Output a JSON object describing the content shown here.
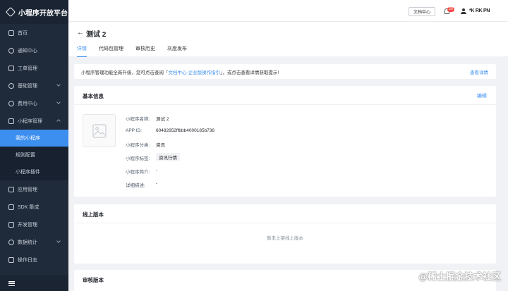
{
  "brand": {
    "title": "小程序开放平台"
  },
  "sidebar": {
    "items": [
      {
        "label": "首页"
      },
      {
        "label": "通知中心"
      },
      {
        "label": "工单管理"
      },
      {
        "label": "基础管理"
      },
      {
        "label": "费用中心"
      },
      {
        "label": "小程序管理"
      },
      {
        "label": "我的小程序"
      },
      {
        "label": "规则配置"
      },
      {
        "label": "小程序插件"
      },
      {
        "label": "应用管理"
      },
      {
        "label": "SDK 集成"
      },
      {
        "label": "开发管理"
      },
      {
        "label": "数据统计"
      },
      {
        "label": "操作日志"
      }
    ]
  },
  "header": {
    "doc_button": "文档中心",
    "notif_count": "20",
    "username": "*K RK PN"
  },
  "page": {
    "back": "←",
    "title": "测试 2",
    "tabs": [
      {
        "label": "详情"
      },
      {
        "label": "代码包管理"
      },
      {
        "label": "审核历史"
      },
      {
        "label": "灰度发布"
      }
    ]
  },
  "notice": {
    "text_before": "小程序管理功能全新升级，您可点击查阅「",
    "link": "文档中心-企业版操作指引",
    "text_after": "」，或点击查看详情获取提示!",
    "action": "查看详情"
  },
  "basic_info": {
    "title": "基本信息",
    "edit": "编辑",
    "fields": [
      {
        "label": "小程序名称:",
        "value": "测试 2"
      },
      {
        "label": "APP ID:",
        "value": "60482852ffbbb4000185b736"
      },
      {
        "label": "小程序分类:",
        "value": "资讯"
      },
      {
        "label": "小程序标签:",
        "value": "资讯行情"
      },
      {
        "label": "小程序简介:",
        "value": "-"
      },
      {
        "label": "详细描述:",
        "value": "-"
      }
    ]
  },
  "online_version": {
    "title": "线上版本",
    "empty": "暂未上架线上版本"
  },
  "review_version": {
    "title": "审核版本"
  },
  "watermark": "@稀土掘金技术社区"
}
